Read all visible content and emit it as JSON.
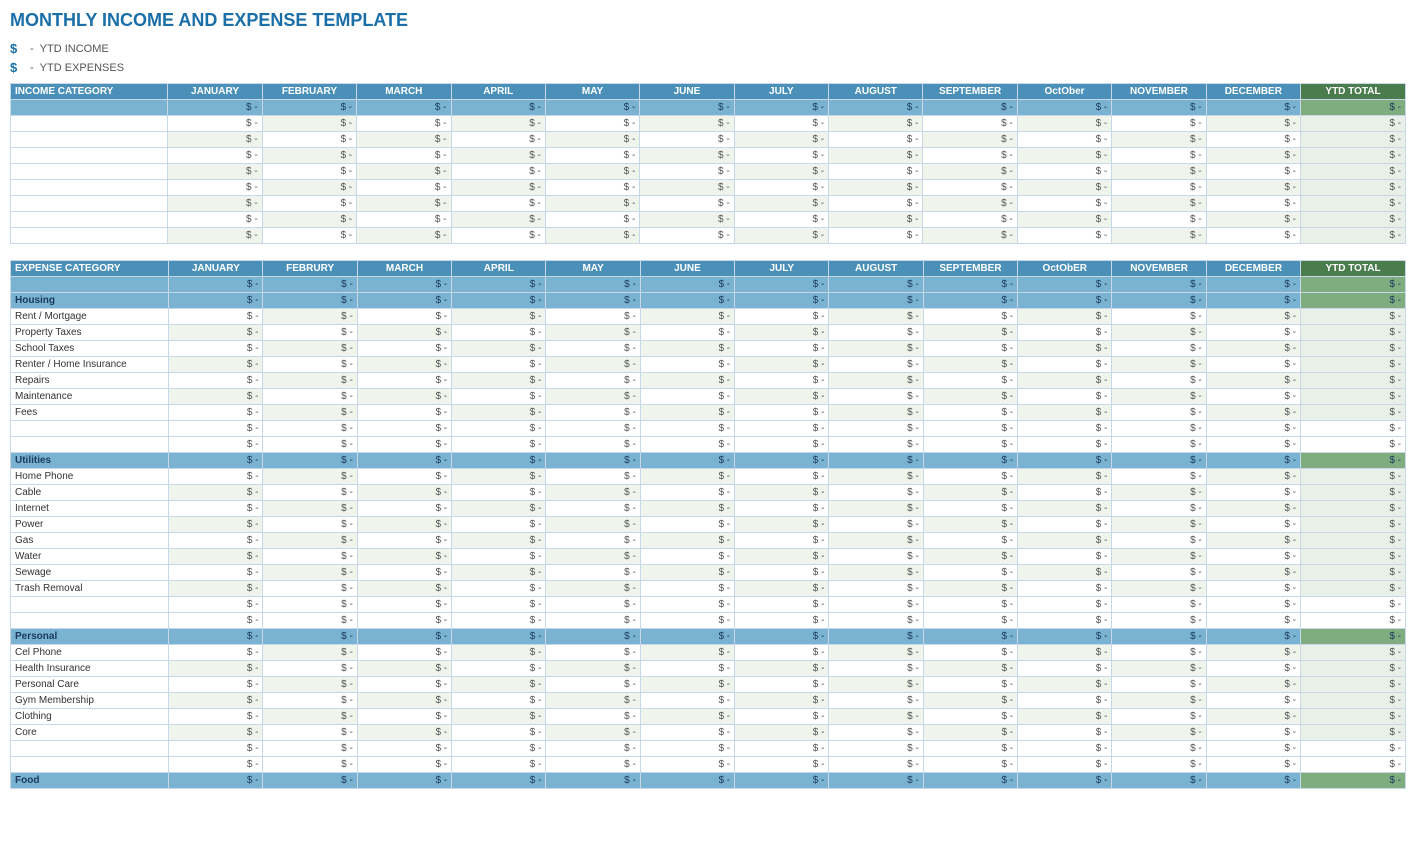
{
  "title": "MONTHLY INCOME AND EXPENSE TEMPLATE",
  "summary": {
    "income_label": "YTD INCOME",
    "expense_label": "YTD EXPENSES",
    "dollar_sign": "$"
  },
  "months": [
    "JANUARY",
    "FEBRUARY",
    "MARCH",
    "APRIL",
    "MAY",
    "JUNE",
    "JULY",
    "AUGUST",
    "SEPTEMBER",
    "OCTOBER",
    "NOVEMBER",
    "DECEMBER"
  ],
  "months_expense": [
    "JANUARY",
    "FEBRURY",
    "MARCH",
    "APRIL",
    "MAY",
    "JUNE",
    "JULY",
    "AUGUST",
    "SEPTEMBER",
    "OCTOBER",
    "NOVEMBER",
    "DECEMBER"
  ],
  "ytd": "YTD TOTAL",
  "income_category_label": "INCOME CATEGORY",
  "expense_category_label": "EXPENSE CATEGORY",
  "dollar_dash": "$ -",
  "sections": {
    "housing": {
      "label": "Housing",
      "items": [
        "Rent / Mortgage",
        "Property Taxes",
        "School Taxes",
        "Renter / Home Insurance",
        "Repairs",
        "Maintenance",
        "Fees"
      ]
    },
    "utilities": {
      "label": "Utilities",
      "items": [
        "Home Phone",
        "Cable",
        "Internet",
        "Power",
        "Gas",
        "Water",
        "Sewage",
        "Trash Removal"
      ]
    },
    "personal": {
      "label": "Personal",
      "items": [
        "Cell Phone",
        "Health Insurance",
        "Personal Care",
        "Gym Membership",
        "Clothing"
      ]
    },
    "food": {
      "label": "Food",
      "items": []
    }
  }
}
